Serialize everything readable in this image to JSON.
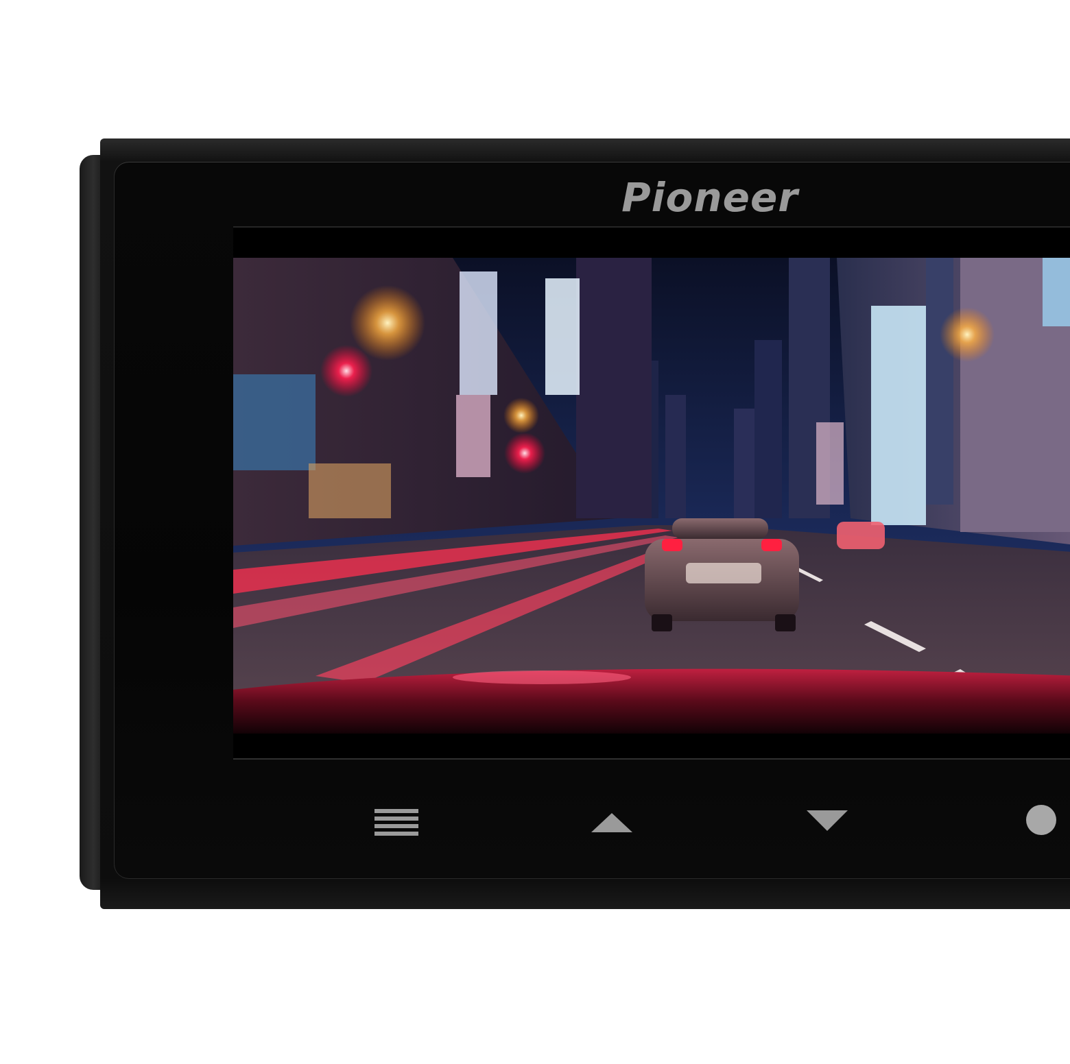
{
  "device": {
    "brand": "Pioneer",
    "colors": {
      "body": "#0a0a0a",
      "logo": "#9a9a9a",
      "button_glyph": "#9a9a9a"
    }
  },
  "screen": {
    "scene": "night-city-street-dashcam-view"
  },
  "buttons": [
    {
      "icon": "menu-icon"
    },
    {
      "icon": "triangle-up-icon"
    },
    {
      "icon": "triangle-down-icon"
    },
    {
      "icon": "record-dot-icon"
    }
  ]
}
